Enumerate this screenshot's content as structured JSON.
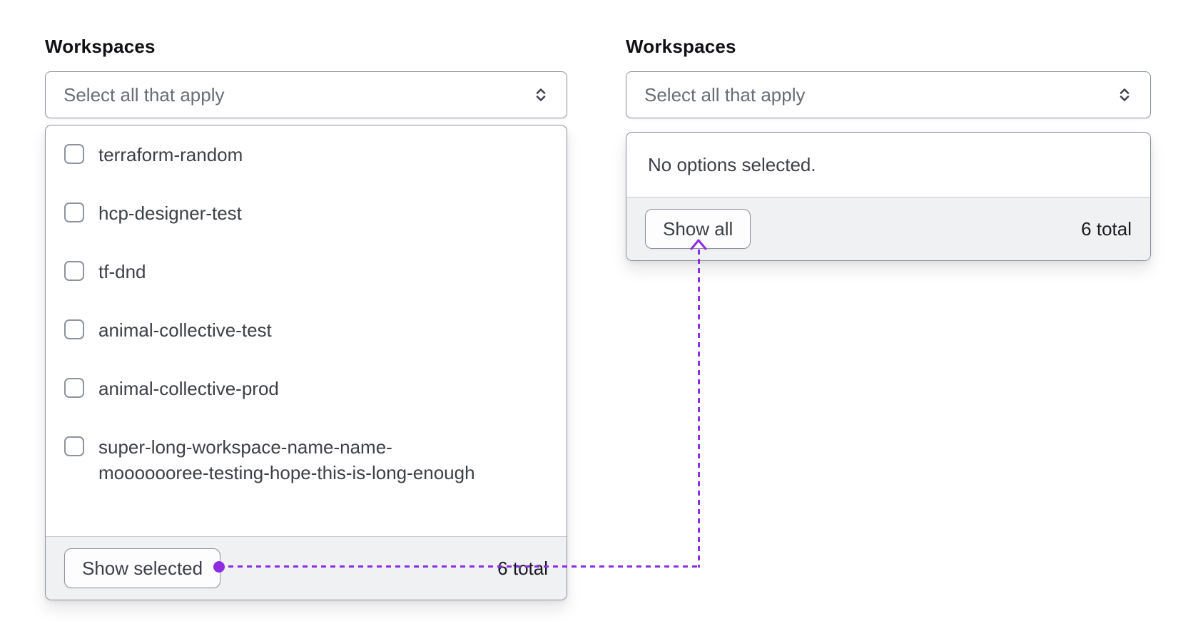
{
  "left": {
    "label": "Workspaces",
    "select": {
      "placeholder": "Select all that apply"
    },
    "options": [
      {
        "label": "terraform-random",
        "checked": false
      },
      {
        "label": "hcp-designer-test",
        "checked": false
      },
      {
        "label": "tf-dnd",
        "checked": false
      },
      {
        "label": "animal-collective-test",
        "checked": false
      },
      {
        "label": "animal-collective-prod",
        "checked": false
      },
      {
        "label": "super-long-workspace-name-name-mooooooree-testing-hope-this-is-long-enough",
        "label_lines": [
          "super-long-workspace-name-name-",
          "mooooooree-testing-hope-this-is-long-enough"
        ],
        "checked": false
      }
    ],
    "footer": {
      "button": "Show selected",
      "total": "6 total"
    }
  },
  "right": {
    "label": "Workspaces",
    "select": {
      "placeholder": "Select all that apply"
    },
    "empty_message": "No options selected.",
    "footer": {
      "button": "Show all",
      "total": "6 total"
    }
  },
  "annotation": {
    "accent_color": "#8d2ce2"
  }
}
